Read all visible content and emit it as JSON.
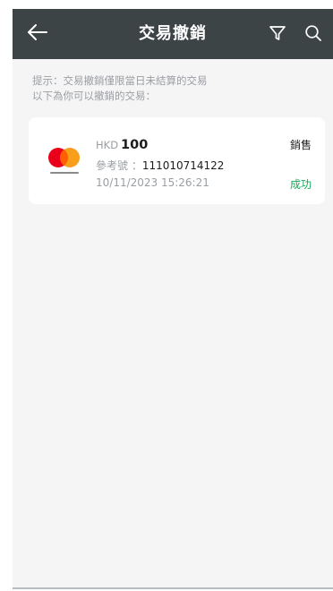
{
  "header": {
    "title": "交易撤銷",
    "back_icon": "arrow-left-icon",
    "filter_icon": "filter-icon",
    "search_icon": "search-icon"
  },
  "hint": {
    "line1": "提示：交易撤銷僅限當日未結算的交易",
    "line2": "以下為你可以撤銷的交易："
  },
  "transactions": [
    {
      "card_brand": "mastercard",
      "currency": "HKD",
      "amount": "100",
      "reference_label": "參考號 ：",
      "reference_number": "111010714122",
      "datetime": "10/11/2023 15:26:21",
      "type": "銷售",
      "status": "成功"
    }
  ],
  "colors": {
    "header_bg": "#3d4446",
    "page_bg": "#f5f5f6",
    "status_success": "#17a85a",
    "mastercard_red": "#eb001b",
    "mastercard_orange": "#f79e1b",
    "mastercard_overlap": "#ff5f00"
  }
}
